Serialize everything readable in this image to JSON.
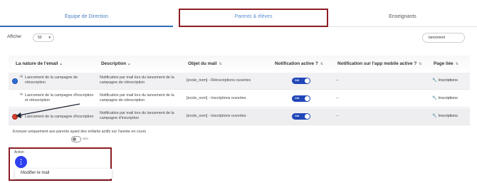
{
  "tabs": [
    {
      "label": "Équipe de Direction",
      "active": true
    },
    {
      "label": "Parents & élèves",
      "highlighted": true
    },
    {
      "label": "Enseignants"
    }
  ],
  "toolbar": {
    "show_label": "Afficher",
    "page_size": "50",
    "search_value": "lancement"
  },
  "table": {
    "headers": [
      "La nature de l'email",
      "Description",
      "Objet du mail",
      "Notification active ?",
      "Notification sur l'app mobile active ?",
      "Page liée"
    ],
    "rows": [
      {
        "nature": "Lancement de la campagne de réinscription",
        "nature_lines": [
          "Lancement de la campagne de",
          "réinscription"
        ],
        "description_lines": [
          "Notification par mail lors du lancement de la",
          "campagne de réinscription"
        ],
        "subject": "[ecole_nom] - Réinscriptions ouvertes",
        "toggle": "OUI",
        "mobile": "--",
        "page": "Inscriptions",
        "dot_color": "#2e6bd6"
      },
      {
        "nature": "Lancement de la campagne d'inscription et réinscription",
        "nature_lines": [
          "Lancement de la campagne d'inscription",
          "et réinscription"
        ],
        "description_lines": [
          "Notification par mail lors du lancement de la",
          "campagne de réinscription"
        ],
        "subject": "[ecole_nom] - Inscriptions ouvertes",
        "toggle": "OUI",
        "mobile": "--",
        "page": "Inscriptions",
        "dot_color": "#2e6bd6"
      },
      {
        "nature": "Lancement de la campagne d'inscription",
        "nature_lines": [
          "Lancement de la campagne d'inscription",
          ""
        ],
        "description_lines": [
          "Notification par mail lors du lancement de la",
          "campagne d'inscription"
        ],
        "subject": "[ecole_nom] - Inscriptions ouvertes",
        "toggle": "OUI",
        "mobile": "--",
        "page": "Inscriptions",
        "dot_color": "#d8402f"
      }
    ]
  },
  "send_only": {
    "label": "Envoyer uniquement aux parents ayant des enfants actifs sur l'année en cours",
    "switch_label": "NON"
  },
  "action": {
    "label": "Action",
    "menu_item": "Modifier le mail"
  },
  "colors": {
    "accent": "#2f6db5",
    "highlight_border": "#8b1e24",
    "toggle_on": "#2147b8",
    "action_button": "#2d3ff0"
  },
  "icons": [
    "sort-icon",
    "mail-icon",
    "wrench-icon",
    "chevron-down-icon",
    "more-vertical-icon"
  ]
}
